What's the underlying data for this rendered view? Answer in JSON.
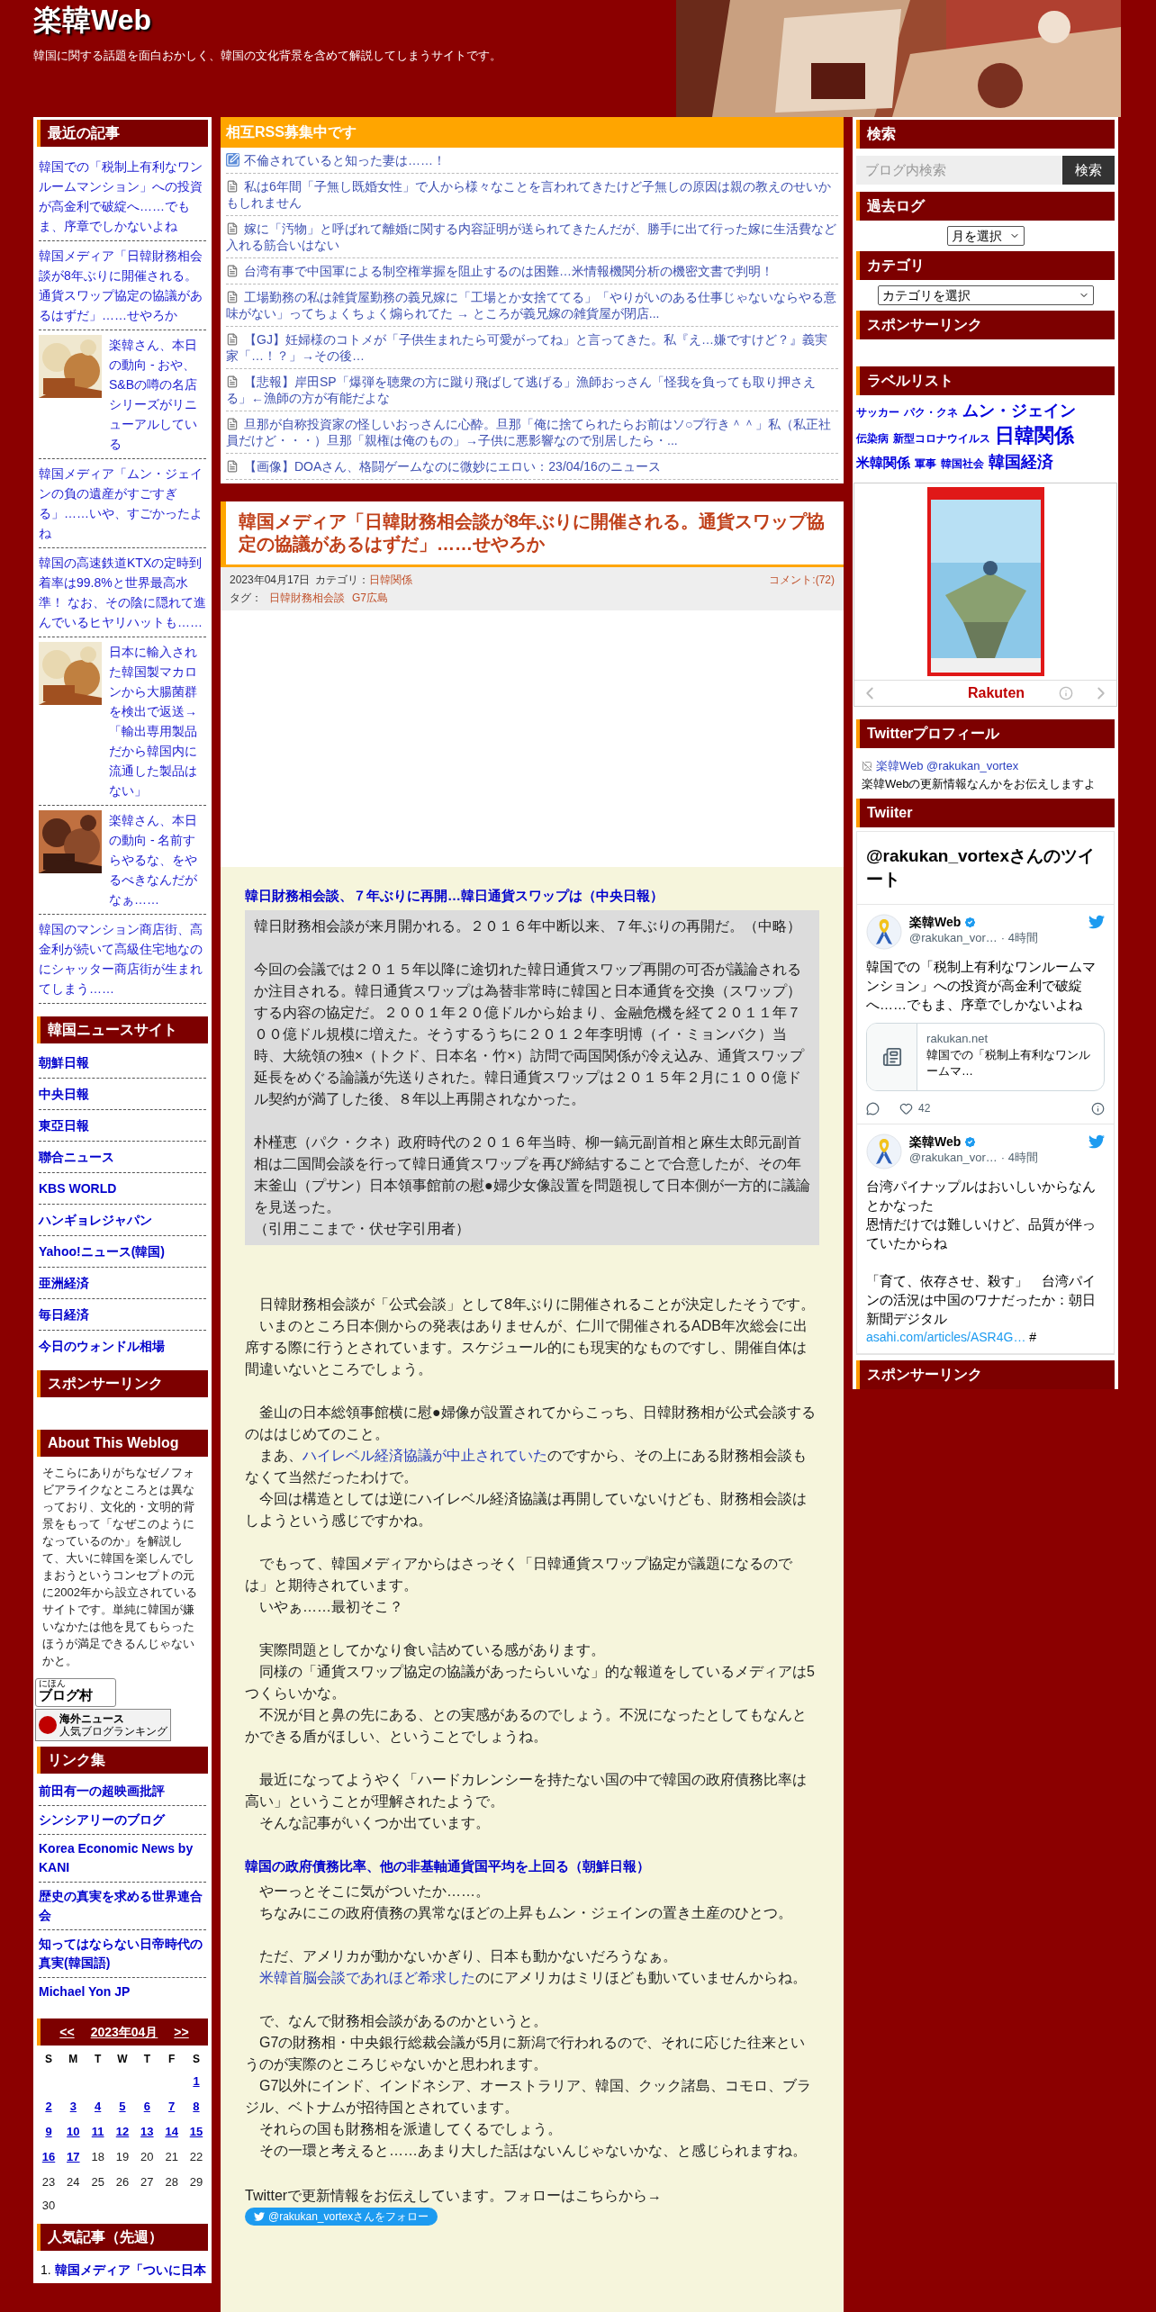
{
  "header": {
    "title": "楽韓Web",
    "tagline": "韓国に関する話題を面白おかしく、韓国の文化背景を含めて解説してしまうサイトです。"
  },
  "left": {
    "recent": {
      "title": "最近の記事",
      "items": [
        {
          "text": "韓国での「税制上有利なワンルームマンション」への投資が高金利で破綻へ……でもま、序章でしかないよね",
          "thumb": false
        },
        {
          "text": "韓国メディア「日韓財務相会談が8年ぶりに開催される。通貨スワップ協定の協議があるはずだ」……せやろか",
          "thumb": false
        },
        {
          "text": "楽韓さん、本日の動向 - おや、S&Bの噂の名店シリーズがリニューアルしている",
          "thumb": true
        },
        {
          "text": "韓国メディア「ムン・ジェインの負の遺産がすごすぎる」……いや、すごかったよね",
          "thumb": false
        },
        {
          "text": "韓国の高速鉄道KTXの定時到着率は99.8%と世界最高水準！ なお、その陰に隠れて進んでいるヒヤリハットも……",
          "thumb": false
        },
        {
          "text": "日本に輸入された韓国製マカロンから大腸菌群を検出で返送→「輸出専用製品だから韓国内に流通した製品はない」",
          "thumb": true
        },
        {
          "text": "楽韓さん、本日の動向 - 名前すらやるな、をやるべきなんだがなぁ……",
          "thumb": true
        },
        {
          "text": "韓国のマンション商店街、高金利が続いて高級住宅地なのにシャッター商店街が生まれてしまう……",
          "thumb": false
        }
      ]
    },
    "news": {
      "title": "韓国ニュースサイト",
      "links": [
        "朝鮮日報",
        "中央日報",
        "東亞日報",
        "聯合ニュース",
        "KBS WORLD",
        "ハンギョレジャパン",
        "Yahoo!ニュース(韓国)",
        "亜洲経済",
        "毎日経済",
        "今日のウォンドル相場"
      ]
    },
    "sponsor": {
      "title": "スポンサーリンク"
    },
    "about": {
      "title": "About This Weblog",
      "text": "そこらにありがちなゼノフォビアライクなところとは異なっており、文化的・文明的背景をもって「なぜこのようになっているのか」を解説して、大いに韓国を楽しんでしまおうというコンセプトの元に2002年から設立されているサイトです。単純に韓国が嫌いなかたは他を見てもらったほうが満足できるんじゃないかと。"
    },
    "banners": [
      {
        "kind": "village",
        "small": "にほん",
        "label": "ブログ村"
      },
      {
        "kind": "ranking",
        "label": "海外ニュース",
        "small": "人気ブログランキング"
      }
    ],
    "links": {
      "title": "リンク集",
      "items": [
        "前田有一の超映画批評",
        "シンシアリーのブログ",
        "Korea Economic News by KANI",
        "歴史の真実を求める世界連合会",
        "知ってはならない日帝時代の真実(韓国語)",
        "Michael Yon JP"
      ]
    },
    "calendar": {
      "prev": "<<",
      "month": "2023年04月",
      "next": ">>",
      "weekdays": [
        "S",
        "M",
        "T",
        "W",
        "T",
        "F",
        "S"
      ],
      "weeks": [
        {
          "kind": "lead",
          "days": [
            {
              "day": "1",
              "linked": true
            }
          ]
        },
        {
          "kind": "full",
          "days": [
            {
              "day": "2",
              "linked": true
            },
            {
              "day": "3",
              "linked": true
            },
            {
              "day": "4",
              "linked": true
            },
            {
              "day": "5",
              "linked": true
            },
            {
              "day": "6",
              "linked": true
            },
            {
              "day": "7",
              "linked": true
            },
            {
              "day": "8",
              "linked": true
            }
          ]
        },
        {
          "kind": "full",
          "days": [
            {
              "day": "9",
              "linked": true
            },
            {
              "day": "10",
              "linked": true
            },
            {
              "day": "11",
              "linked": true
            },
            {
              "day": "12",
              "linked": true
            },
            {
              "day": "13",
              "linked": true
            },
            {
              "day": "14",
              "linked": true
            },
            {
              "day": "15",
              "linked": true
            }
          ]
        },
        {
          "kind": "full",
          "days": [
            {
              "day": "16",
              "linked": true
            },
            {
              "day": "17",
              "linked": true
            },
            {
              "day": "18",
              "linked": false
            },
            {
              "day": "19",
              "linked": false
            },
            {
              "day": "20",
              "linked": false
            },
            {
              "day": "21",
              "linked": false
            },
            {
              "day": "22",
              "linked": false
            }
          ]
        },
        {
          "kind": "full",
          "days": [
            {
              "day": "23",
              "linked": false
            },
            {
              "day": "24",
              "linked": false
            },
            {
              "day": "25",
              "linked": false
            },
            {
              "day": "26",
              "linked": false
            },
            {
              "day": "27",
              "linked": false
            },
            {
              "day": "28",
              "linked": false
            },
            {
              "day": "29",
              "linked": false
            }
          ]
        },
        {
          "kind": "tail",
          "days": [
            {
              "day": "30",
              "linked": false
            }
          ]
        }
      ]
    },
    "popular": {
      "title": "人気記事（先週）",
      "items": [
        {
          "rank": "1.",
          "text": "韓国メディア「ついに日本"
        }
      ]
    }
  },
  "center": {
    "rss": {
      "title": "相互RSS募集中です",
      "items": [
        {
          "kind": "pen",
          "text": "不倫されていると知った妻は……！"
        },
        {
          "kind": "doc",
          "text": "私は6年間「子無し既婚女性」で人から様々なことを言われてきたけど子無しの原因は親の教えのせいかもしれません"
        },
        {
          "kind": "doc",
          "text": "嫁に「汚物」と呼ばれて離婚に関する内容証明が送られてきたんだが、勝手に出て行った嫁に生活費など入れる筋合いはない"
        },
        {
          "kind": "doc",
          "text": "台湾有事で中国軍による制空権掌握を阻止するのは困難…米情報機関分析の機密文書で判明！"
        },
        {
          "kind": "doc",
          "text": "工場勤務の私は雑貨屋勤務の義兄嫁に「工場とか女捨ててる」「やりがいのある仕事じゃないならやる意味がない」ってちょくちょく煽られてた → ところが義兄嫁の雑貨屋が閉店..."
        },
        {
          "kind": "doc",
          "text": "【GJ】妊婦様のコトメが「子供生まれたら可愛がってね」と言ってきた。私『え…嫌ですけど？』義実家「…！？」→その後…"
        },
        {
          "kind": "doc",
          "text": "【悲報】岸田SP「爆弾を聴衆の方に蹴り飛ばして逃げる」漁師おっさん「怪我を負っても取り押さえる」←漁師の方が有能だよな"
        },
        {
          "kind": "doc",
          "text": "旦那が自称投資家の怪しいおっさんに心酔。旦那「俺に捨てられたらお前はソ○プ行き＾＾」私（私正社員だけど・・・）旦那「親権は俺のもの」→子供に悪影響なので別居したら・..."
        },
        {
          "kind": "doc",
          "text": "【画像】DOAさん、格闘ゲームなのに微妙にエロい：23/04/16のニュース"
        }
      ]
    },
    "article": {
      "title": "韓国メディア「日韓財務相会談が8年ぶりに開催される。通貨スワップ協定の協議があるはずだ」……せやろか",
      "date": "2023年04月17日",
      "category_label": "カテゴリ：",
      "category": "日韓関係",
      "comments": "コメント:(72)",
      "tags_label": "タグ：",
      "tags": [
        "日韓財務相会談",
        "G7広島"
      ],
      "blocks": [
        {
          "kind": "heading",
          "text": "韓日財務相会談、７年ぶりに再開…韓日通貨スワップは（中央日報）"
        },
        {
          "kind": "quote",
          "paragraphs": [
            [
              "韓日財務相会談が来月開かれる。２０１６年中断以来、７年ぶりの再開だ。（中略）"
            ],
            [
              "今回の会議では２０１５年以降に途切れた韓日通貨スワップ再開の可否が議論されるか注目される。韓日通貨スワップは為替非常時に韓国と日本通貨を交換（スワップ）する内容の協定だ。２００１年２０億ドルから始まり、金融危機を経て２０１１年７００億ドル規模に増えた。そうするうちに２０１２年李明博（イ・ミョンバク）当時、大統領の独×（トクド、日本名・竹×）訪問で両国関係が冷え込み、通貨スワップ延長をめぐる論議が先送りされた。韓日通貨スワップは２０１５年２月に１００億ドル契約が満了した後、８年以上再開されなかった。"
            ],
            [
              "朴槿恵（パク・クネ）政府時代の２０１６年当時、柳一鎬元副首相と麻生太郎元副首相は二国間会談を行って韓日通貨スワップを再び締結することで合意したが、その年末釜山（プサン）日本領事館前の慰●婦少女像設置を問題視して日本側が一方的に議論を見送った。",
              "（引用ここまで・伏せ字引用者）"
            ]
          ]
        },
        {
          "kind": "para",
          "lines": [
            [
              {
                "text": "日韓財務相会談が「公式会談」として8年ぶりに開催されることが決定したそうです。",
                "link": false
              }
            ],
            [
              {
                "text": "いまのところ日本側からの発表はありませんが、仁川で開催されるADB年次総会に出席する際に行うとされています。スケジュール的にも現実的なものですし、開催自体は間違いないところでしょう。",
                "link": false
              }
            ]
          ]
        },
        {
          "kind": "para",
          "lines": [
            [
              {
                "text": "釜山の日本総領事館横に慰●婦像が設置されてからこっち、日韓財務相が公式会談するのははじめてのこと。",
                "link": false
              }
            ],
            [
              {
                "text": "まあ、",
                "link": false
              },
              {
                "text": "ハイレベル経済協議が中止されていた",
                "link": true
              },
              {
                "text": "のですから、その上にある財務相会談もなくて当然だったわけで。",
                "link": false
              }
            ],
            [
              {
                "text": "今回は構造としては逆にハイレベル経済協議は再開していないけども、財務相会談はしようという感じですかね。",
                "link": false
              }
            ]
          ]
        },
        {
          "kind": "para",
          "lines": [
            [
              {
                "text": "でもって、韓国メディアからはさっそく「日韓通貨スワップ協定が議題になるのでは」と期待されています。",
                "link": false
              }
            ],
            [
              {
                "text": "いやぁ……最初そこ？",
                "link": false
              }
            ]
          ]
        },
        {
          "kind": "para",
          "lines": [
            [
              {
                "text": "実際問題としてかなり食い詰めている感があります。",
                "link": false
              }
            ],
            [
              {
                "text": "同様の「通貨スワップ協定の協議があったらいいな」的な報道をしているメディアは5つくらいかな。",
                "link": false
              }
            ],
            [
              {
                "text": "不況が目と鼻の先にある、との実感があるのでしょう。不況になったとしてもなんとかできる盾がほしい、ということでしょうね。",
                "link": false
              }
            ]
          ]
        },
        {
          "kind": "para",
          "lines": [
            [
              {
                "text": "最近になってようやく「ハードカレンシーを持たない国の中で韓国の政府債務比率は高い」ということが理解されたようで。",
                "link": false
              }
            ],
            [
              {
                "text": "そんな記事がいくつか出ています。",
                "link": false
              }
            ]
          ]
        },
        {
          "kind": "heading",
          "text": "韓国の政府債務比率、他の非基軸通貨国平均を上回る（朝鮮日報）"
        },
        {
          "kind": "para",
          "lines": [
            [
              {
                "text": "やーっとそこに気がついたか……。",
                "link": false
              }
            ],
            [
              {
                "text": "ちなみにこの政府債務の異常なほどの上昇もムン・ジェインの置き土産のひとつ。",
                "link": false
              }
            ]
          ]
        },
        {
          "kind": "para",
          "lines": [
            [
              {
                "text": "ただ、アメリカが動かないかぎり、日本も動かないだろうなぁ。",
                "link": false
              }
            ],
            [
              {
                "text": "米韓首脳会談であれほど希求した",
                "link": true
              },
              {
                "text": "のにアメリカはミリほども動いていませんからね。",
                "link": false
              }
            ]
          ]
        },
        {
          "kind": "para",
          "lines": [
            [
              {
                "text": "で、なんで財務相会談があるのかというと。",
                "link": false
              }
            ],
            [
              {
                "text": "G7の財務相・中央銀行総裁会議が5月に新潟で行われるので、それに応じた往来というのが実際のところじゃないかと思われます。",
                "link": false
              }
            ],
            [
              {
                "text": "G7以外にインド、インドネシア、オーストラリア、韓国、クック諸島、コモロ、ブラジル、ベトナムが招待国とされています。",
                "link": false
              }
            ],
            [
              {
                "text": "それらの国も財務相を派遣してくるでしょう。",
                "link": false
              }
            ],
            [
              {
                "text": "その一環と考えると……あまり大した話はないんじゃないかな、と感じられますね。",
                "link": false
              }
            ]
          ]
        },
        {
          "kind": "follow",
          "text": "Twitterで更新情報をお伝えしています。フォローはこちらから→",
          "button": "@rakukan_vortexさんをフォロー"
        }
      ]
    }
  },
  "right": {
    "search": {
      "title": "検索",
      "placeholder": "ブログ内検索",
      "button": "検索"
    },
    "archive": {
      "title": "過去ログ",
      "select": "月を選択"
    },
    "category": {
      "title": "カテゴリ",
      "select": "カテゴリを選択"
    },
    "sponsor": {
      "title": "スポンサーリンク"
    },
    "labels": {
      "title": "ラベルリスト",
      "tags": [
        {
          "text": "サッカー",
          "kind": "s"
        },
        {
          "text": "パク・クネ",
          "kind": "s"
        },
        {
          "text": "ムン・ジェイン",
          "kind": "l"
        },
        {
          "text": "伝染病",
          "kind": "s"
        },
        {
          "text": "新型コロナウイルス",
          "kind": "s"
        },
        {
          "text": "日韓関係",
          "kind": "xl"
        },
        {
          "text": "米韓関係",
          "kind": "m"
        },
        {
          "text": "軍事",
          "kind": "s"
        },
        {
          "text": "韓国社会",
          "kind": "s"
        },
        {
          "text": "韓国経済",
          "kind": "l"
        }
      ]
    },
    "rakuten": {
      "logo": "Rakuten"
    },
    "profile": {
      "title": "Twitterプロフィール",
      "link": "楽韓Web @rakukan_vortex",
      "text": "楽韓Webの更新情報なんかをお伝えしますよ"
    },
    "twitter": {
      "title": "Twiiter",
      "heading": "@rakukan_vortexさんのツイート",
      "tweets": [
        {
          "name": "楽韓Web",
          "handle": "@rakukan_vor…",
          "time": "· 4時間",
          "paragraphs": [
            [
              "韓国での「税制上有利なワンルームマンション」への投資が高金利で破綻へ……でもま、序章でしかないよね"
            ]
          ],
          "card": {
            "domain": "rakukan.net",
            "title": "韓国での「税制上有利なワンルームマ…"
          },
          "likes": "42"
        },
        {
          "name": "楽韓Web",
          "handle": "@rakukan_vor…",
          "time": "· 4時間",
          "paragraphs": [
            [
              "台湾パイナップルはおいしいからなんとかなった",
              "恩情だけでは難しいけど、品質が伴っていたからね"
            ],
            [
              "「育て、依存させ、殺す」　台湾パインの活況は中国のワナだったか：朝日新聞デジタル"
            ]
          ],
          "link": "asahi.com/articles/ASR4G…",
          "tail": "#"
        }
      ]
    },
    "sponsor2": {
      "title": "スポンサーリンク"
    }
  }
}
